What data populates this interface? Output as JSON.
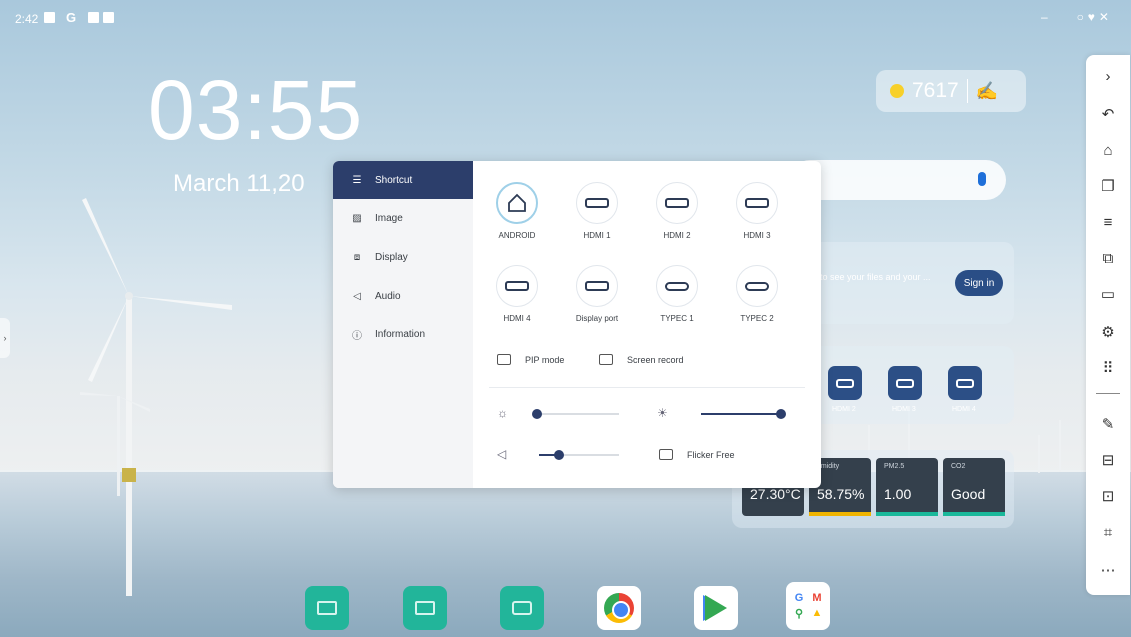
{
  "status": {
    "time": "2:42",
    "g_label": "G"
  },
  "clock": {
    "time": "03:55",
    "date": "March 11,20"
  },
  "points": {
    "value": "7617"
  },
  "signin": {
    "text": "to see your files and your ...",
    "button": "Sign in"
  },
  "source_widget": {
    "labels": [
      "HDMI 2",
      "HDMI 3",
      "HDMI 4"
    ]
  },
  "env": {
    "items": [
      {
        "label": "",
        "value": "27.30°C",
        "bar": "#19b89a"
      },
      {
        "label": "umidity",
        "value": "58.75%",
        "bar": "#f0b400"
      },
      {
        "label": "PM2.5",
        "value": "1.00",
        "bar": "#19b89a"
      },
      {
        "label": "CO2",
        "value": "Good",
        "bar": "#19b89a"
      }
    ]
  },
  "panel": {
    "menu": [
      {
        "label": "Shortcut",
        "icon": "sliders-icon",
        "active": true
      },
      {
        "label": "Image",
        "icon": "image-icon",
        "active": false
      },
      {
        "label": "Display",
        "icon": "display-icon",
        "active": false
      },
      {
        "label": "Audio",
        "icon": "speaker-icon",
        "active": false
      },
      {
        "label": "Information",
        "icon": "info-icon",
        "active": false
      }
    ],
    "sources": [
      {
        "label": "ANDROID",
        "icon": "home-icon",
        "selected": true
      },
      {
        "label": "HDMI 1",
        "icon": "hdmi-icon"
      },
      {
        "label": "HDMI 2",
        "icon": "hdmi-icon"
      },
      {
        "label": "HDMI 3",
        "icon": "hdmi-icon"
      },
      {
        "label": "HDMI 4",
        "icon": "hdmi-icon"
      },
      {
        "label": "Display port",
        "icon": "displayport-icon"
      },
      {
        "label": "TYPEC 1",
        "icon": "usb-c-icon"
      },
      {
        "label": "TYPEC 2",
        "icon": "usb-c-icon"
      }
    ],
    "pip_label": "PIP mode",
    "record_label": "Screen record",
    "flicker_label": "Flicker Free",
    "brightness_level": 0.05,
    "backlight_level": 1.0,
    "volume_level": 0.25
  },
  "dock": [
    "whiteboard-app",
    "screen-share-app",
    "file-manager-app",
    "chrome-app",
    "play-store-app",
    "google-apps-folder"
  ]
}
